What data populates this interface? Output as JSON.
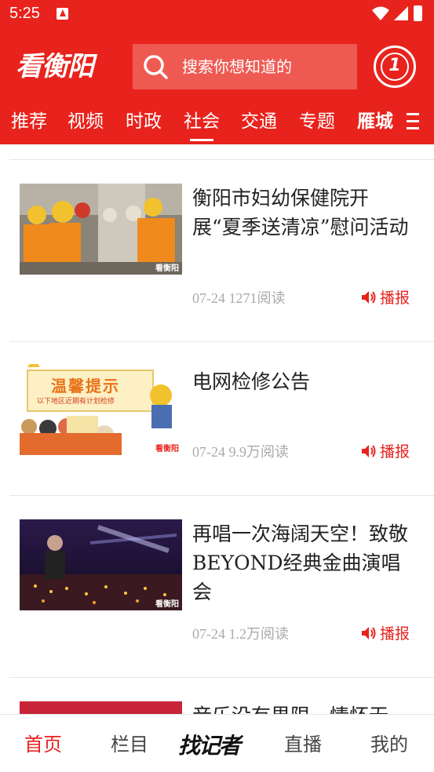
{
  "status_bar": {
    "time": "5:25"
  },
  "header": {
    "logo_text": "看衡阳",
    "search_placeholder": "搜索你想知道的",
    "badge_text": "1"
  },
  "tabs": [
    {
      "label": "推荐",
      "active": false
    },
    {
      "label": "视频",
      "active": false
    },
    {
      "label": "时政",
      "active": false
    },
    {
      "label": "社会",
      "active": true
    },
    {
      "label": "交通",
      "active": false
    },
    {
      "label": "专题",
      "active": false
    },
    {
      "label": "雁城",
      "active": false
    }
  ],
  "feed": [
    {
      "title": "衡阳市妇幼保健院开展“夏季送清凉”慰问活动",
      "date": "07-24",
      "reads": "1271阅读",
      "play_label": "播报",
      "thumb_watermark": "看衡阳"
    },
    {
      "title": "电网检修公告",
      "date": "07-24",
      "reads": "9.9万阅读",
      "play_label": "播报",
      "thumb_headline": "温馨提示",
      "thumb_subline": "以下地区近期有计划检修",
      "thumb_watermark": "看衡阳"
    },
    {
      "title": "再唱一次海阔天空！致敬BEYOND经典金曲演唱会",
      "date": "07-24",
      "reads": "1.2万阅读",
      "play_label": "播报",
      "thumb_watermark": "看衡阳"
    },
    {
      "title": "音乐没有界限，情怀无"
    }
  ],
  "bottom_nav": [
    {
      "label": "首页",
      "active": true
    },
    {
      "label": "栏目",
      "active": false
    },
    {
      "label": "找记者",
      "active": false
    },
    {
      "label": "直播",
      "active": false
    },
    {
      "label": "我的",
      "active": false
    }
  ],
  "colors": {
    "brand_red": "#e8231d",
    "search_bg": "#ee5a52",
    "meta_gray": "#aaaaaa"
  }
}
